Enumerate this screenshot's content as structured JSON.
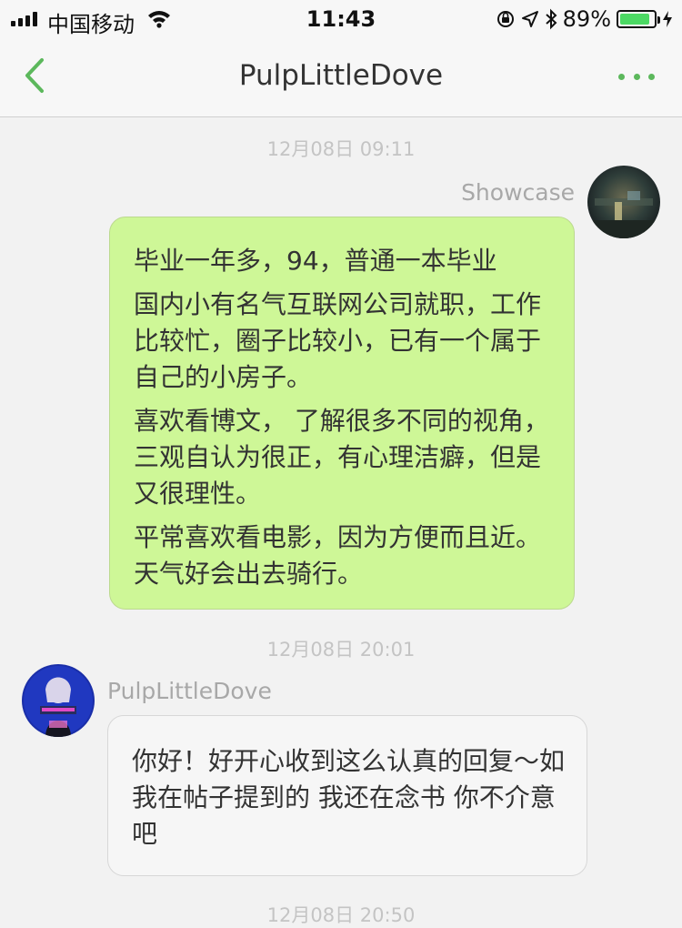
{
  "status_bar": {
    "carrier": "中国移动",
    "time": "11:43",
    "battery_percent": "89%",
    "battery_level": 0.89,
    "icons": [
      "signal-icon",
      "wifi-icon",
      "orientation-lock-icon",
      "location-icon",
      "bluetooth-icon",
      "battery-icon",
      "charging-icon"
    ]
  },
  "nav": {
    "title": "PulpLittleDove",
    "back_icon": "chevron-left-icon",
    "more_icon": "more-dots-icon",
    "accent_color": "#5cb85c"
  },
  "messages": [
    {
      "timestamp": "12月08日 09:11",
      "sender": "Showcase",
      "direction": "outgoing",
      "paragraphs": [
        "毕业一年多，94，普通一本毕业",
        "国内小有名气互联网公司就职，工作比较忙，圈子比较小，已有一个属于自己的小房子。",
        "喜欢看博文， 了解很多不同的视角，三观自认为很正，有心理洁癖，但是又很理性。",
        "平常喜欢看电影，因为方便而且近。 天气好会出去骑行。"
      ],
      "bubble_color": "#cef797"
    },
    {
      "timestamp": "12月08日 20:01",
      "sender": "PulpLittleDove",
      "direction": "incoming",
      "paragraphs": [
        "你好！好开心收到这么认真的回复～如我在帖子提到的 我还在念书 你不介意吧"
      ],
      "bubble_color": "#f6f6f6"
    },
    {
      "timestamp": "12月08日 20:50"
    }
  ]
}
